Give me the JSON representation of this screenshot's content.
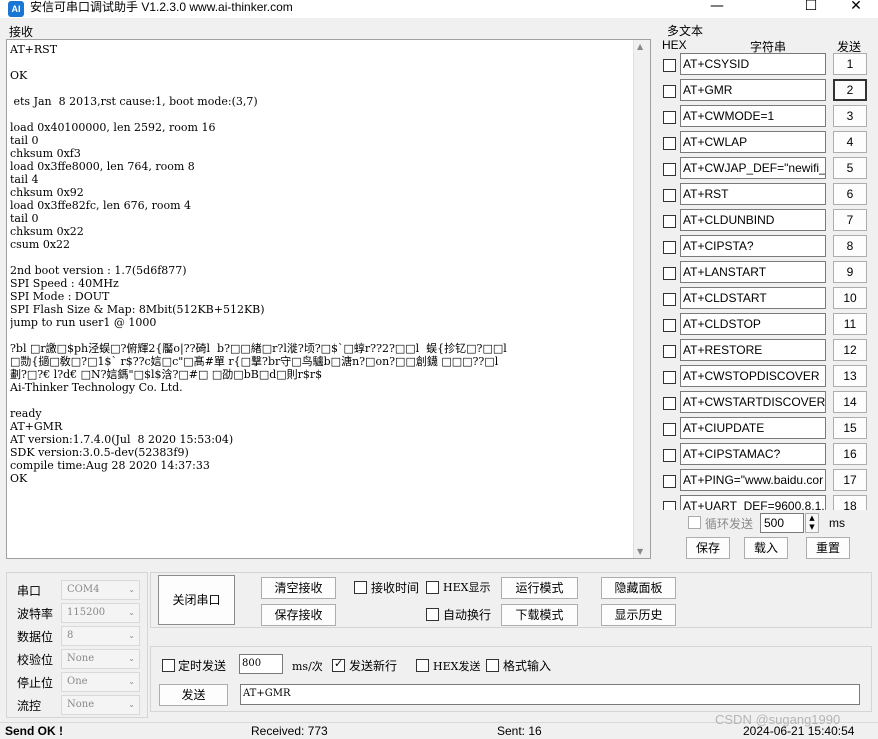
{
  "window": {
    "icon_text": "AI",
    "title": "安信可串口调试助手 V1.2.3.0     www.ai-thinker.com",
    "minimize": "—",
    "maximize": "☐",
    "close": "✕"
  },
  "receive": {
    "label": "接收",
    "lines": [
      "AT+RST",
      "",
      "OK",
      "",
      " ets Jan  8 2013,rst cause:1, boot mode:(3,7)",
      "",
      "load 0x40100000, len 2592, room 16",
      "tail 0",
      "chksum 0xf3",
      "load 0x3ffe8000, len 764, room 8",
      "tail 4",
      "chksum 0x92",
      "load 0x3ffe82fc, len 676, room 4",
      "tail 0",
      "chksum 0x22",
      "csum 0x22",
      "",
      "2nd boot version : 1.7(5d6f877)",
      "SPI Speed : 40MHz",
      "SPI Mode : DOUT",
      "SPI Flash Size & Map: 8Mbit(512KB+512KB)",
      "jump to run user1 @ 1000",
      "",
      "?bl □r譤□$ph泾蜈□?俯輝2{靨o|??碕l  b?□□緖□r?l漇?顷?□$`□蜳r??2?□□l  蜈{抮钇□?□□l",
      "□勚{擿□敎□?□1$` r$??c娮□c\"□髙#單 r{□撃?br守□鸟驢b□溏n?□on?□□創鑖 □□□??□l",
      "劃?□?€ l?d€ □N?娮鎷\"□$l$浛?□#□ □劭□bB□d□則r$r$",
      "Ai-Thinker Technology Co. Ltd.",
      "",
      "ready",
      "AT+GMR",
      "AT version:1.7.4.0(Jul  8 2020 15:53:04)",
      "SDK version:3.0.5-dev(52383f9)",
      "compile time:Aug 28 2020 14:37:33",
      "OK"
    ]
  },
  "multitext": {
    "label": "多文本",
    "col_hex": "HEX",
    "col_string": "字符串",
    "col_send": "发送",
    "rows": [
      {
        "text": "AT+CSYSID",
        "btn": "1"
      },
      {
        "text": "AT+GMR",
        "btn": "2"
      },
      {
        "text": "AT+CWMODE=1",
        "btn": "3"
      },
      {
        "text": "AT+CWLAP",
        "btn": "4"
      },
      {
        "text": "AT+CWJAP_DEF=\"newifi_",
        "btn": "5"
      },
      {
        "text": "AT+RST",
        "btn": "6"
      },
      {
        "text": "AT+CLDUNBIND",
        "btn": "7"
      },
      {
        "text": "AT+CIPSTA?",
        "btn": "8"
      },
      {
        "text": "AT+LANSTART",
        "btn": "9"
      },
      {
        "text": "AT+CLDSTART",
        "btn": "10"
      },
      {
        "text": "AT+CLDSTOP",
        "btn": "11"
      },
      {
        "text": "AT+RESTORE",
        "btn": "12"
      },
      {
        "text": "AT+CWSTOPDISCOVER",
        "btn": "13"
      },
      {
        "text": "AT+CWSTARTDISCOVER=",
        "btn": "14"
      },
      {
        "text": "AT+CIUPDATE",
        "btn": "15"
      },
      {
        "text": "AT+CIPSTAMAC?",
        "btn": "16"
      },
      {
        "text": "AT+PING=\"www.baidu.cor",
        "btn": "17"
      },
      {
        "text": "AT+UART_DEF=9600,8,1,",
        "btn": "18"
      }
    ],
    "loop_label": "循环发送",
    "loop_ms": "500",
    "ms_unit": "ms",
    "save": "保存",
    "load": "载入",
    "reset": "重置"
  },
  "port": {
    "port_label": "串口",
    "port_value": "COM4",
    "baud_label": "波特率",
    "baud_value": "115200",
    "databits_label": "数据位",
    "databits_value": "8",
    "parity_label": "校验位",
    "parity_value": "None",
    "stopbits_label": "停止位",
    "stopbits_value": "One",
    "flow_label": "流控",
    "flow_value": "None"
  },
  "controls": {
    "close_port": "关闭串口",
    "clear_recv": "清空接收",
    "save_recv": "保存接收",
    "recv_time": "接收时间",
    "hex_display": "HEX显示",
    "auto_wrap": "自动换行",
    "run_mode": "运行模式",
    "download_mode": "下载模式",
    "hide_panel": "隐藏面板",
    "show_history": "显示历史"
  },
  "send": {
    "timed_send": "定时发送",
    "interval": "800",
    "interval_unit": "ms/次",
    "send_newline": "发送新行",
    "hex_send": "HEX发送",
    "format_input": "格式输入",
    "send_button": "发送",
    "send_text": "AT+GMR"
  },
  "status": {
    "message": "Send OK !",
    "received": "Received: 773",
    "sent": "Sent: 16",
    "datetime": "2024-06-21 15:40:54"
  },
  "watermark": "CSDN @sugang1990"
}
